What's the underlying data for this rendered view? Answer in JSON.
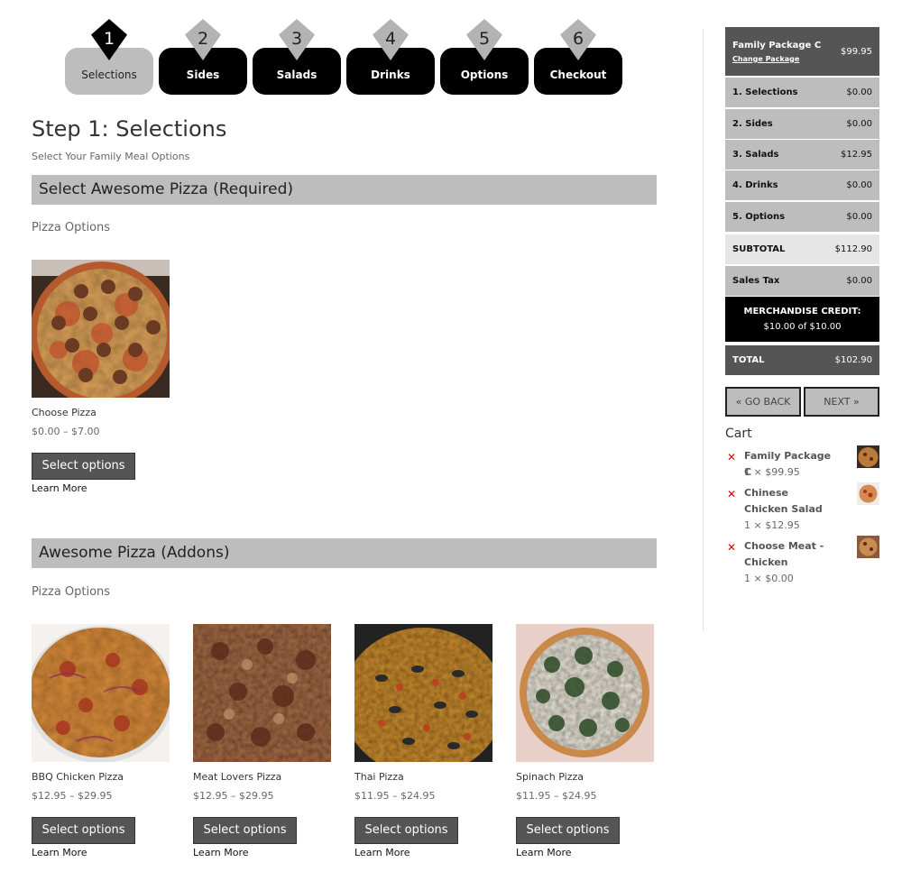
{
  "wizard": {
    "steps": [
      {
        "number": "1",
        "label": "Selections",
        "active": true
      },
      {
        "number": "2",
        "label": "Sides",
        "active": false
      },
      {
        "number": "3",
        "label": "Salads",
        "active": false
      },
      {
        "number": "4",
        "label": "Drinks",
        "active": false
      },
      {
        "number": "5",
        "label": "Options",
        "active": false
      },
      {
        "number": "6",
        "label": "Checkout",
        "active": false
      }
    ]
  },
  "page": {
    "title": "Step 1: Selections",
    "subtitle": "Select Your Family Meal Options"
  },
  "sections": [
    {
      "heading": "Select Awesome Pizza (Required)",
      "subheading": "Pizza Options",
      "products": [
        {
          "name": "Choose Pizza",
          "price": "$0.00 – $7.00",
          "button": "Select options",
          "link": "Learn More",
          "image": "pepperoni-meatball-pizza"
        }
      ]
    },
    {
      "heading": "Awesome Pizza (Addons)",
      "subheading": "Pizza Options",
      "products": [
        {
          "name": "BBQ Chicken Pizza",
          "price": "$12.95 – $29.95",
          "button": "Select options",
          "link": "Learn More",
          "image": "bbq-chicken-pizza"
        },
        {
          "name": "Meat Lovers Pizza",
          "price": "$12.95 – $29.95",
          "button": "Select options",
          "link": "Learn More",
          "image": "meat-lovers-pizza"
        },
        {
          "name": "Thai Pizza",
          "price": "$11.95 – $24.95",
          "button": "Select options",
          "link": "Learn More",
          "image": "thai-pizza"
        },
        {
          "name": "Spinach Pizza",
          "price": "$11.95 – $24.95",
          "button": "Select options",
          "link": "Learn More",
          "image": "spinach-pizza"
        }
      ]
    }
  ],
  "summary": {
    "package_name": "Family Package C",
    "change_link": "Change Package",
    "package_price": "$99.95",
    "lines": [
      {
        "label": "1. Selections",
        "amount": "$0.00"
      },
      {
        "label": "2. Sides",
        "amount": "$0.00"
      },
      {
        "label": "3. Salads",
        "amount": "$12.95"
      },
      {
        "label": "4. Drinks",
        "amount": "$0.00"
      },
      {
        "label": "5. Options",
        "amount": "$0.00"
      }
    ],
    "subtotal_label": "SUBTOTAL",
    "subtotal": "$112.90",
    "tax_label": "Sales Tax",
    "tax": "$0.00",
    "credit_label": "MERCHANDISE CREDIT:",
    "credit_value": "$10.00 of $10.00",
    "total_label": "TOTAL",
    "total": "$102.90"
  },
  "nav": {
    "back": "« GO BACK",
    "next": "NEXT »"
  },
  "cart": {
    "title": "Cart",
    "items": [
      {
        "name": "Family Package C",
        "qty": "1 × $99.95",
        "icon": "remove-icon"
      },
      {
        "name": "Chinese Chicken Salad",
        "qty": "1 × $12.95",
        "icon": "remove-icon"
      },
      {
        "name": "Choose Meat - Chicken",
        "qty": "1 × $0.00",
        "icon": "remove-icon"
      }
    ]
  },
  "colors": {
    "accent_dark": "#555555",
    "bar_gray": "#bdbdbd",
    "remove_red": "#dd0000"
  }
}
